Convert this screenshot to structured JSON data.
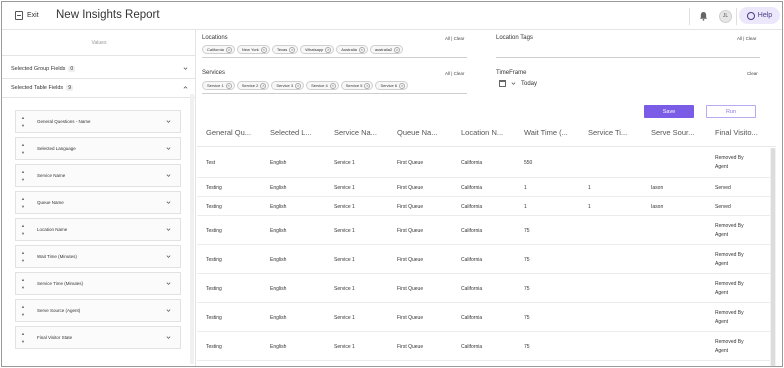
{
  "header": {
    "exit_label": "Exit",
    "title": "New Insights Report",
    "avatar_initials": "JL",
    "help_label": "Help"
  },
  "left_panel": {
    "values_label": "Values",
    "group_fields_label": "Selected Group Fields",
    "group_fields_count": "0",
    "table_fields_label": "Selected Table Fields",
    "table_fields_count": "9",
    "fields": [
      "General Questions - Name",
      "Selected Language",
      "Service Name",
      "Queue Name",
      "Location Name",
      "Wait Time (Minutes)",
      "Service Time (Minutes)",
      "Serve Source (Agent)",
      "Final Visitor State"
    ]
  },
  "filters": {
    "locations": {
      "title": "Locations",
      "links": "All | Clear",
      "chips": [
        "California",
        "New York",
        "Texas",
        "Whatsapp",
        "Australia",
        "australia2"
      ]
    },
    "location_tags": {
      "title": "Location Tags",
      "links": "All | Clear"
    },
    "services": {
      "title": "Services",
      "links": "All | Clear",
      "chips": [
        "Service 1",
        "Service 2",
        "Service 3",
        "Service 4",
        "Service 5",
        "Service 6"
      ]
    },
    "timeframe": {
      "title": "TimeFrame",
      "value": "Today",
      "clear": "Clear"
    }
  },
  "actions": {
    "save_label": "Save",
    "run_label": "Run"
  },
  "table": {
    "columns": [
      "General Qu...",
      "Selected L...",
      "Service Na...",
      "Queue Na...",
      "Location N...",
      "Wait Time (...",
      "Service Ti...",
      "Serve Sour...",
      "Final Visito..."
    ],
    "rows": [
      [
        "Test",
        "English",
        "Service 1",
        "First Queue",
        "California",
        "550",
        "",
        "",
        "Removed By Agent"
      ],
      [
        "Testing",
        "English",
        "Service 1",
        "First Queue",
        "California",
        "1",
        "1",
        "Iason",
        "Served"
      ],
      [
        "Testing",
        "English",
        "Service 1",
        "First Queue",
        "California",
        "1",
        "1",
        "Iason",
        "Served"
      ],
      [
        "Testing",
        "English",
        "Service 1",
        "First Queue",
        "California",
        "75",
        "",
        "",
        "Removed By Agent"
      ],
      [
        "Testing",
        "English",
        "Service 1",
        "First Queue",
        "California",
        "75",
        "",
        "",
        "Removed By Agent"
      ],
      [
        "Testing",
        "English",
        "Service 1",
        "First Queue",
        "California",
        "75",
        "",
        "",
        "Removed By Agent"
      ],
      [
        "Testing",
        "English",
        "Service 1",
        "First Queue",
        "California",
        "75",
        "",
        "",
        "Removed By Agent"
      ],
      [
        "Testing",
        "English",
        "Service 1",
        "First Queue",
        "California",
        "75",
        "",
        "",
        "Removed By Agent"
      ]
    ]
  },
  "colors": {
    "accent": "#7b5ce6",
    "help_bg": "#ece7fb"
  },
  "icons": [
    "exit-icon",
    "bell-icon",
    "help-icon",
    "chevron-down-icon",
    "chevron-up-icon",
    "drag-handle-icon",
    "close-icon",
    "calendar-icon"
  ]
}
